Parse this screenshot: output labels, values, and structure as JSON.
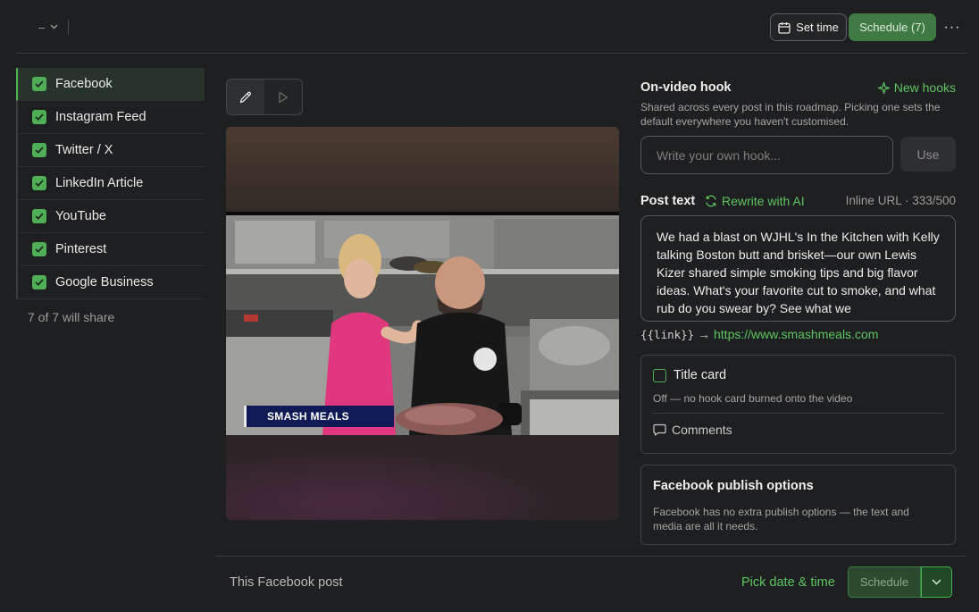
{
  "topbar": {
    "workspace_value": "–",
    "set_time_label": "Set time",
    "schedule_label": "Schedule (7)",
    "more_label": "···"
  },
  "sidebar": {
    "items": [
      {
        "label": "Facebook",
        "checked": true,
        "active": true
      },
      {
        "label": "Instagram Feed",
        "checked": true
      },
      {
        "label": "Twitter / X",
        "checked": true
      },
      {
        "label": "LinkedIn Article",
        "checked": true
      },
      {
        "label": "YouTube",
        "checked": true
      },
      {
        "label": "Pinterest",
        "checked": true
      },
      {
        "label": "Google Business",
        "checked": true
      }
    ],
    "count_text": "7 of 7 will share"
  },
  "media": {
    "lower_third_text": "SMASH MEALS"
  },
  "hook": {
    "title": "On-video hook",
    "new_hooks_label": "New hooks",
    "description": "Shared across every post in this roadmap. Picking one sets the default everywhere you haven't customised.",
    "input_placeholder": "Write your own hook...",
    "use_label": "Use"
  },
  "post": {
    "label": "Post text",
    "rewrite_label": "Rewrite with AI",
    "counter": "Inline URL · 333/500",
    "text": "We had a blast on WJHL's In the Kitchen with Kelly talking Boston butt and brisket—our own Lewis Kizer shared simple smoking tips and big flavor ideas. What's your favorite cut to smoke, and what rub do you swear by? See what we",
    "link_token": "{{link}}",
    "link_arrow": "→",
    "link_url": "https://www.smashmeals.com"
  },
  "title_card": {
    "label": "Title card",
    "description": "Off — no hook card burned onto the video",
    "comments_label": "Comments"
  },
  "publish_options": {
    "title": "Facebook publish options",
    "description": "Facebook has no extra publish options — the text and media are all it needs."
  },
  "footer": {
    "label": "This Facebook post",
    "pick_label": "Pick date & time",
    "schedule_label": "Schedule"
  },
  "colors": {
    "accent": "#4fae56",
    "accent_text": "#5ec462",
    "background": "#1e1f21"
  }
}
